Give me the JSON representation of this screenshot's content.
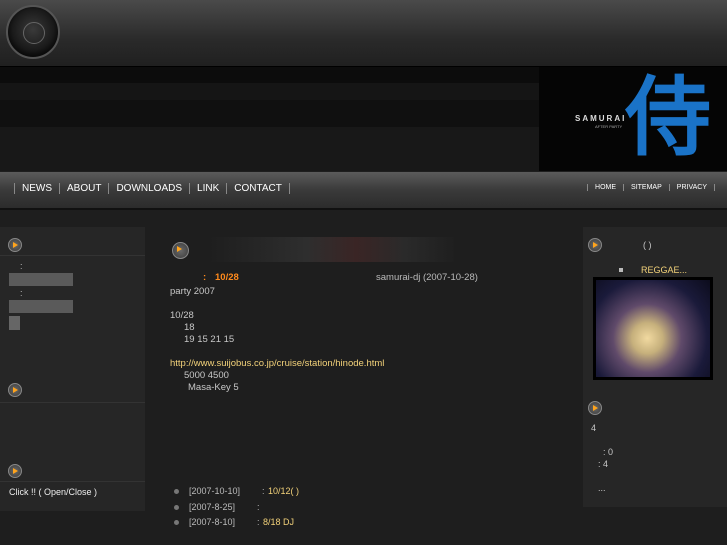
{
  "nav": {
    "items": [
      "NEWS",
      "ABOUT",
      "DOWNLOADS",
      "LINK",
      "CONTACT"
    ],
    "right_items": [
      "HOME",
      "SITEMAP",
      "PRIVACY"
    ]
  },
  "banner": {
    "brand": "SAMURAI",
    "sub": "AFTER PARTY",
    "kanji": "侍"
  },
  "left": {
    "colon1": ":",
    "colon2": ":",
    "toggle": "Click !! ( Open/Close )"
  },
  "post": {
    "date_label": ":",
    "date": "10/28",
    "author": "samurai-dj (2007-10-28)",
    "line1": "party   2007",
    "line2": "10/28",
    "line3": "18",
    "line4": "19 15 21 15",
    "link": "http://www.suijobus.co.jp/cruise/station/hinode.html",
    "line5": "5000     4500",
    "line6": "Masa-Key    5"
  },
  "history": [
    {
      "date": "[2007-10-10]",
      "sep": ":",
      "text": "10/12( )"
    },
    {
      "date": "[2007-8-25]",
      "sep": ":",
      "text": ""
    },
    {
      "date": "[2007-8-10]",
      "sep": ":",
      "text": "8/18     DJ"
    }
  ],
  "right": {
    "paren": "(      )",
    "video_title": "REGGAE...",
    "count_label": "4",
    "stat1": ": 0",
    "stat2": ": 4",
    "more": "..."
  }
}
